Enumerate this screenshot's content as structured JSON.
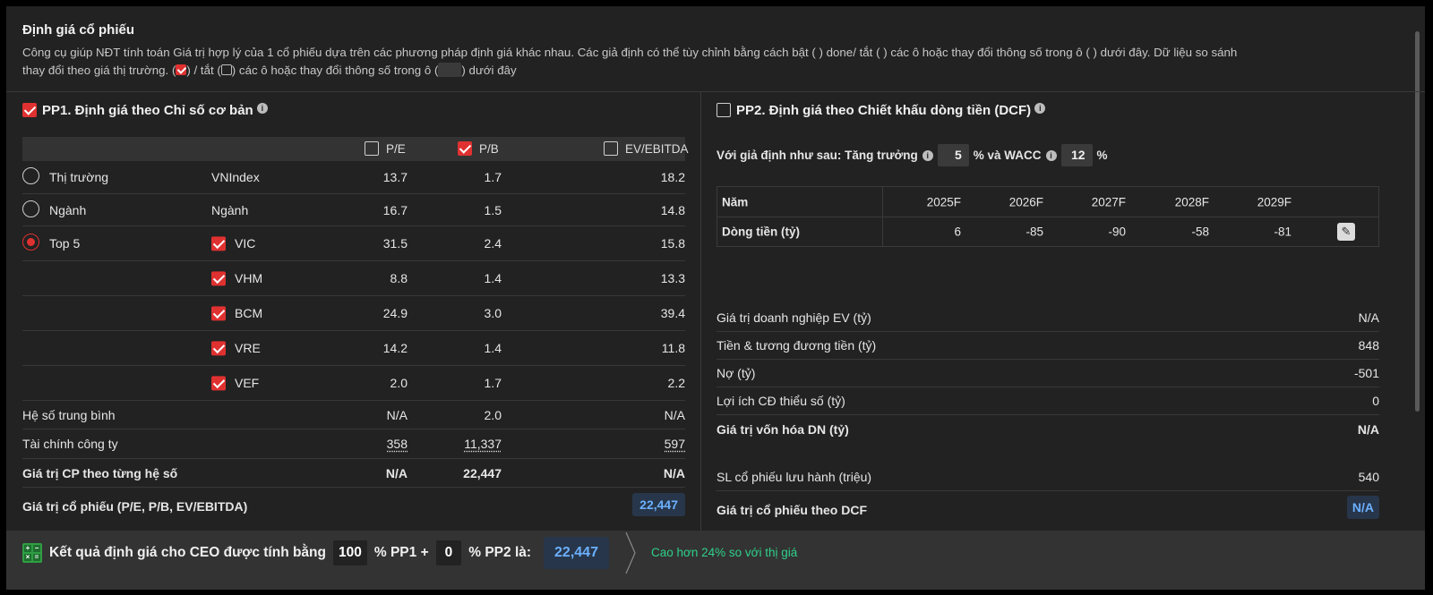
{
  "header": {
    "title": "Định giá cổ phiếu",
    "desc1": "Công cụ giúp NĐT tính toán Giá trị hợp lý của 1 cổ phiếu dựa trên các phương pháp định giá khác nhau. Các giả định có thể tùy chỉnh bằng cách bật ( ) done/ tắt ( ) các ô hoặc thay đổi thông số trong ô ( ) dưới đây. Dữ liệu so sánh",
    "desc2a": "thay đổi theo giá thị trường. (",
    "desc2b": ") / tắt (",
    "desc2c": ") các ô hoặc thay đổi thông số trong ô (",
    "desc2d": ") dưới đây"
  },
  "pp1": {
    "title": "PP1. Định giá theo Chỉ số cơ bản",
    "checked": true,
    "columns": [
      {
        "label": "P/E",
        "checked": false
      },
      {
        "label": "P/B",
        "checked": true
      },
      {
        "label": "EV/EBITDA",
        "checked": false
      }
    ],
    "rows": [
      {
        "radio": "Thị trường",
        "selected": false,
        "name": "VNIndex",
        "pe": "13.7",
        "pb": "1.7",
        "ev": "18.2"
      },
      {
        "radio": "Ngành",
        "selected": false,
        "name": "Ngành",
        "pe": "16.7",
        "pb": "1.5",
        "ev": "14.8"
      },
      {
        "radio": "Top 5",
        "selected": true,
        "name": "VIC",
        "pe": "31.5",
        "pb": "2.4",
        "ev": "15.8",
        "checked": true
      },
      {
        "radio": "",
        "name": "VHM",
        "pe": "8.8",
        "pb": "1.4",
        "ev": "13.3",
        "checked": true
      },
      {
        "radio": "",
        "name": "BCM",
        "pe": "24.9",
        "pb": "3.0",
        "ev": "39.4",
        "checked": true
      },
      {
        "radio": "",
        "name": "VRE",
        "pe": "14.2",
        "pb": "1.4",
        "ev": "11.8",
        "checked": true
      },
      {
        "radio": "",
        "name": "VEF",
        "pe": "2.0",
        "pb": "1.7",
        "ev": "2.2",
        "checked": true
      }
    ],
    "avg": {
      "label": "Hệ số trung bình",
      "pe": "N/A",
      "pb": "2.0",
      "ev": "N/A"
    },
    "fin": {
      "label": "Tài chính công ty",
      "pe": "358",
      "pb": "11,337",
      "ev": "597"
    },
    "val": {
      "label": "Giá trị CP theo từng hệ số",
      "pe": "N/A",
      "pb": "22,447",
      "ev": "N/A"
    },
    "result": {
      "label": "Giá trị cổ phiếu (P/E, P/B, EV/EBITDA)",
      "value": "22,447"
    }
  },
  "pp2": {
    "title": "PP2. Định giá theo Chiết khấu dòng tiền (DCF)",
    "checked": false,
    "assume_label": "Với giả định như sau: Tăng trưởng",
    "growth": "5",
    "pct": "%",
    "and_wacc": "% và WACC",
    "wacc": "12",
    "table": {
      "year_label": "Năm",
      "years": [
        "2025F",
        "2026F",
        "2027F",
        "2028F",
        "2029F"
      ],
      "cf_label": "Dòng tiền (tỷ)",
      "cf": [
        "6",
        "-85",
        "-90",
        "-58",
        "-81"
      ]
    },
    "items": [
      {
        "label": "Giá trị doanh nghiệp EV (tỷ)",
        "value": "N/A"
      },
      {
        "label": "Tiền & tương đương tiền (tỷ)",
        "value": "848"
      },
      {
        "label": "Nợ (tỷ)",
        "value": "-501"
      },
      {
        "label": "Lợi ích CĐ thiểu số (tỷ)",
        "value": "0"
      },
      {
        "label": "Giá trị vốn hóa DN (tỷ)",
        "value": "N/A"
      }
    ],
    "shares": {
      "label": "SL cổ phiếu lưu hành (triệu)",
      "value": "540"
    },
    "result": {
      "label": "Giá trị cổ phiếu theo DCF",
      "value": "N/A"
    }
  },
  "footer": {
    "prefix": "Kết quả định giá cho CEO được tính bằng",
    "pp1_weight": "100",
    "mid": "% PP1 +",
    "pp2_weight": "0",
    "suffix": "% PP2 là:",
    "result": "22,447",
    "note": "Cao hơn 24% so với thị giá"
  },
  "colors": {
    "accent": "#e03131",
    "result_bg": "#27364a",
    "result_fg": "#6cb0ff",
    "positive": "#2fd08a"
  }
}
